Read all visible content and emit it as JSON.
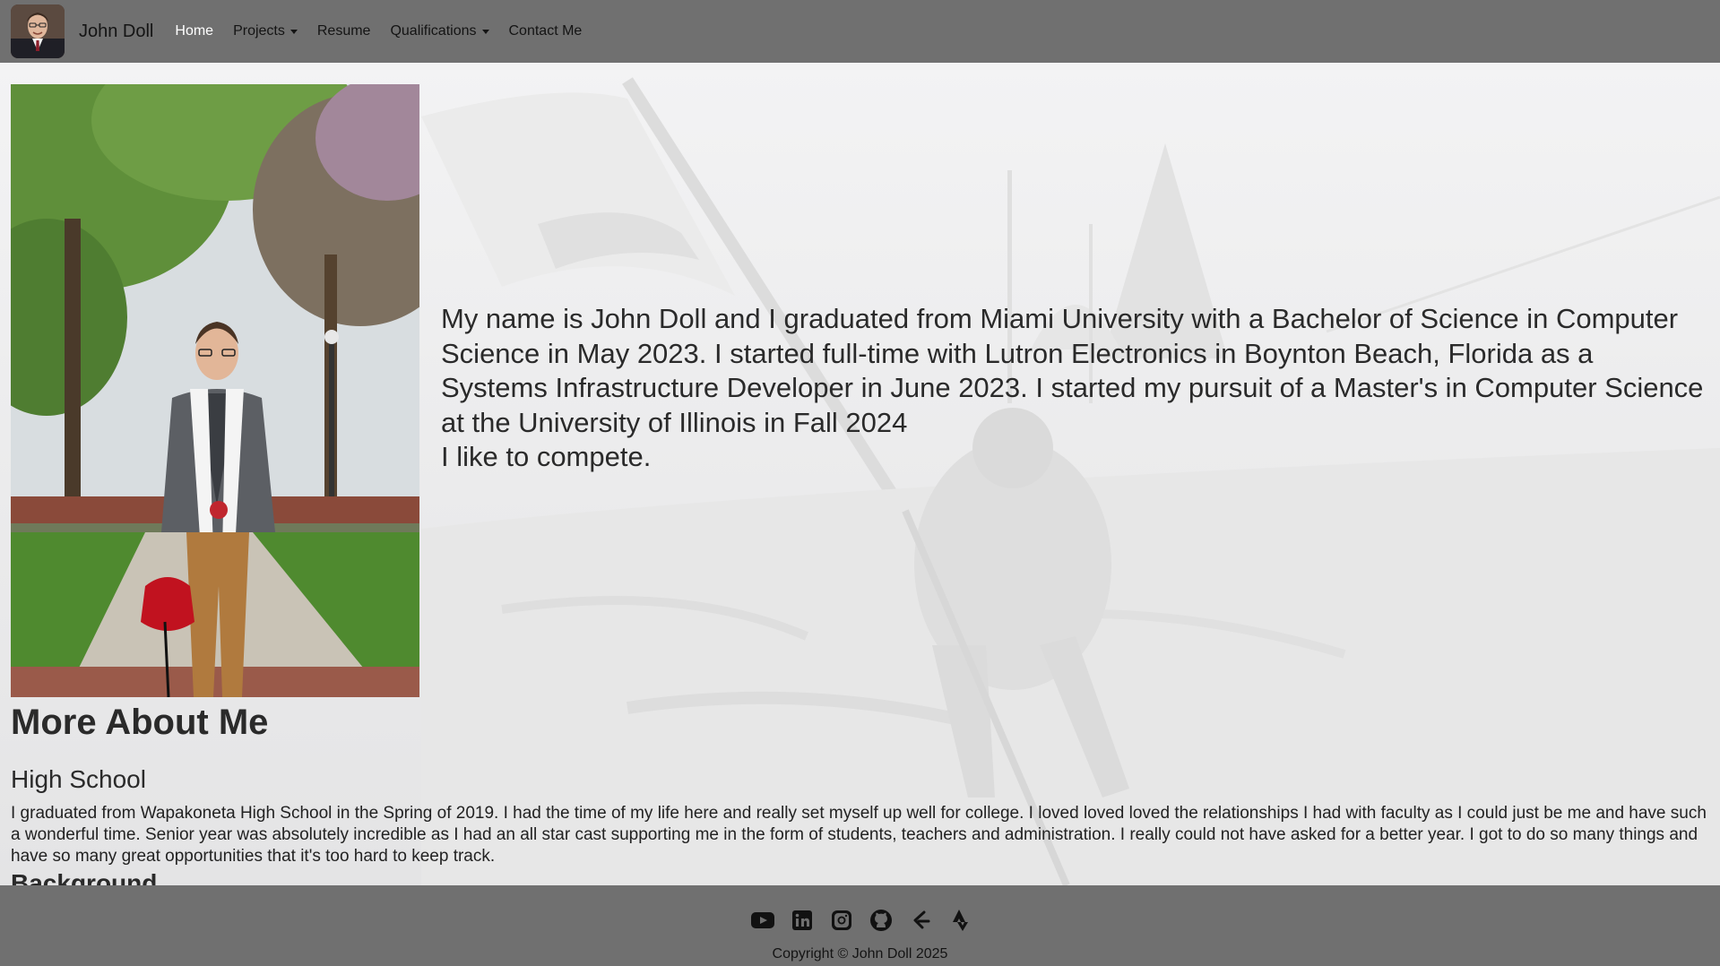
{
  "navbar": {
    "brand_name": "John Doll",
    "items": [
      {
        "label": "Home",
        "active": true,
        "dropdown": false
      },
      {
        "label": "Projects",
        "active": false,
        "dropdown": true
      },
      {
        "label": "Resume",
        "active": false,
        "dropdown": false
      },
      {
        "label": "Qualifications",
        "active": false,
        "dropdown": true
      },
      {
        "label": "Contact Me",
        "active": false,
        "dropdown": false
      }
    ]
  },
  "intro": {
    "paragraph": "My name is John Doll and I graduated from Miami University with a Bachelor of Science in Computer Science in May 2023. I started full-time with Lutron Electronics in Boynton Beach, Florida as a Systems Infrastructure Developer in June 2023. I started my pursuit of a Master's in Computer Science at the University of Illinois in Fall 2024",
    "tagline": "I like to compete."
  },
  "about": {
    "title": "More About Me",
    "sections": [
      {
        "title": "High School",
        "text": "I graduated from Wapakoneta High School in the Spring of 2019. I had the time of my life here and really set myself up well for college. I loved loved loved the relationships I had with faculty as I could just be me and have such a wonderful time. Senior year was absolutely incredible as I had an all star cast supporting me in the form of students, teachers and administration. I really could not have asked for a better year. I got to do so many things and have so many great opportunities that it's too hard to keep track."
      }
    ],
    "next_section_title": "Background"
  },
  "footer": {
    "social_icons": [
      "youtube-icon",
      "linkedin-icon",
      "instagram-icon",
      "github-icon",
      "leetcode-icon",
      "strava-icon"
    ],
    "copyright": "Copyright © John Doll 2025"
  },
  "colors": {
    "nav_bg": "#707070",
    "nav_active": "#ffffff",
    "text": "#2a2a2a"
  }
}
